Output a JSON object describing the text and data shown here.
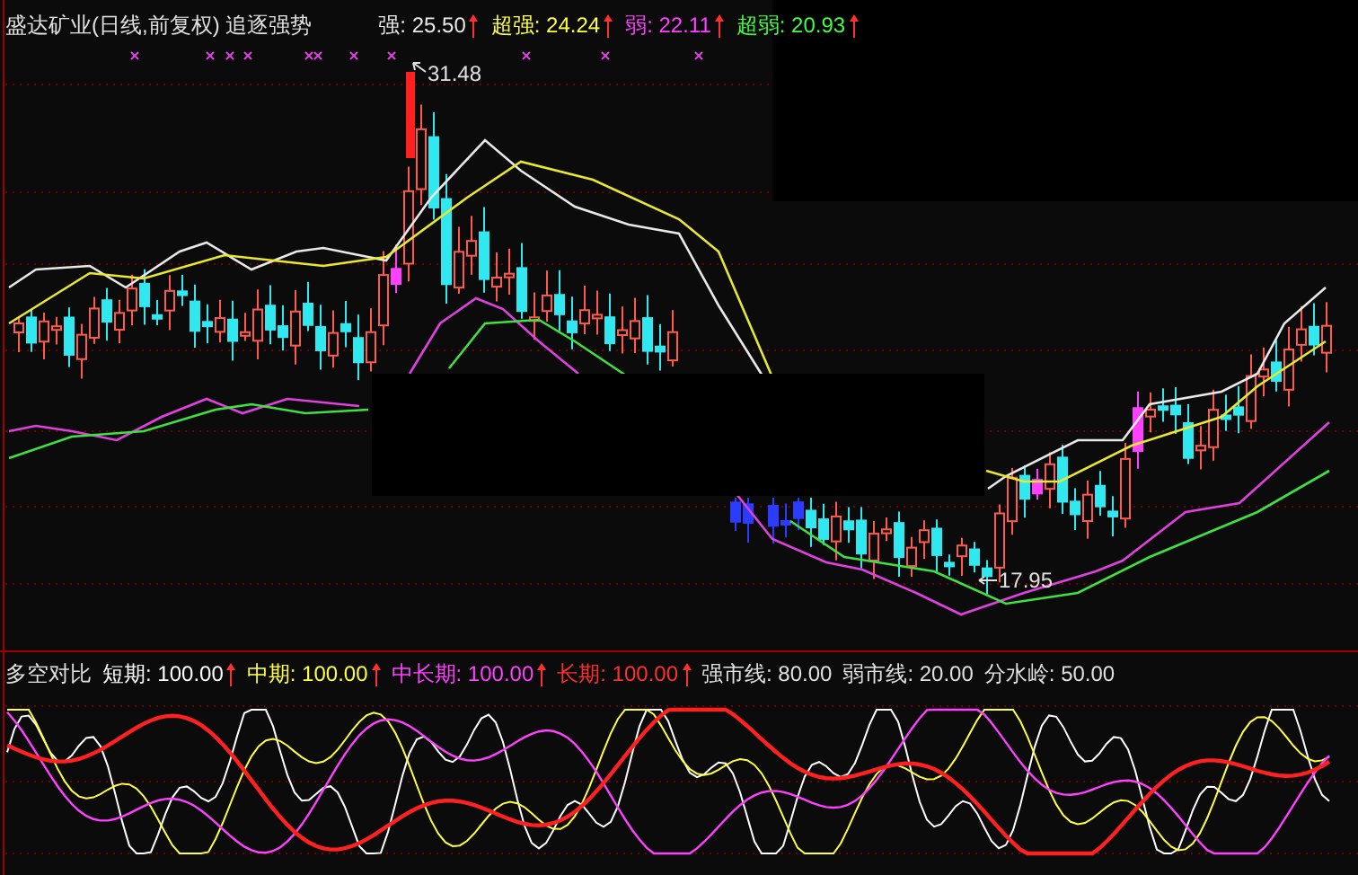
{
  "main_chart": {
    "title": "盛达矿业(日线,前复权) 追逐强势",
    "legend": [
      {
        "text": "强: 25.50",
        "color": "#e8e8e8"
      },
      {
        "text": "超强: 24.24",
        "color": "#ffff40"
      },
      {
        "text": "弱: 22.11",
        "color": "#ff40ff"
      },
      {
        "text": "超弱: 20.93",
        "color": "#40ff40"
      }
    ],
    "high_label": "31.48",
    "low_label": "17.95"
  },
  "sub_chart": {
    "title": "多空对比",
    "legend": [
      {
        "text": "短期: 100.00",
        "color": "#ffffff"
      },
      {
        "text": "中期: 100.00",
        "color": "#ffff40"
      },
      {
        "text": "中长期: 100.00",
        "color": "#ff40ff"
      },
      {
        "text": "长期: 100.00",
        "color": "#ff3030"
      }
    ],
    "levels": [
      "强市线: 80.00",
      "弱市线: 20.00",
      "分水岭: 50.00"
    ]
  }
}
